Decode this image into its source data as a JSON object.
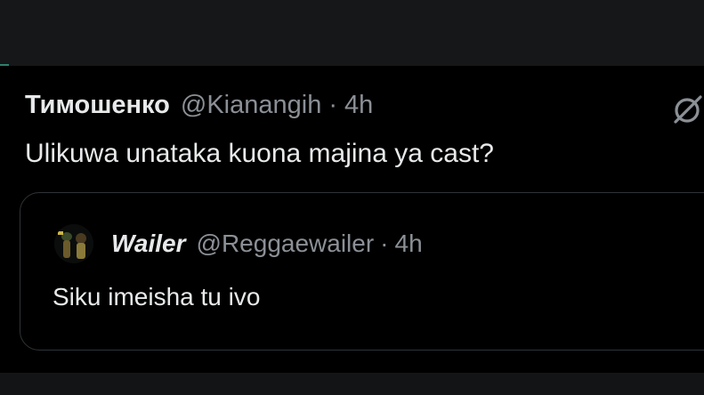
{
  "tweet": {
    "author_name": "Тимошенко",
    "handle": "@Kianangih",
    "separator": "·",
    "time": "4h",
    "text": "Ulikuwa unataka kuona majina ya cast?",
    "grok_icon": "grok-icon"
  },
  "quoted_tweet": {
    "author_name": "Wailer",
    "handle": "@Reggaewailer",
    "separator": "·",
    "time": "4h",
    "text": "Siku imeisha tu ivo",
    "avatar_icon": "avatar"
  },
  "colors": {
    "background": "#000000",
    "primary_text": "#e7e9ea",
    "secondary_text": "#8b9096",
    "border": "#2f3336"
  }
}
